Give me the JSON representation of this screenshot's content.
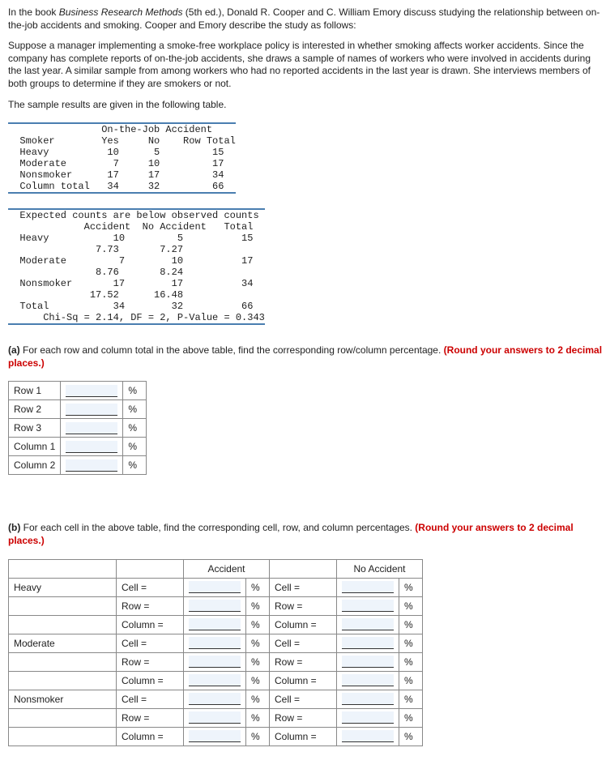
{
  "intro": {
    "line1_a": "In the book ",
    "book": "Business Research Methods",
    "line1_b": " (5th ed.), Donald R. Cooper and C. William Emory discuss studying the relationship between on-the-job accidents and smoking. Cooper and Emory describe the study as follows:",
    "suppose": "Suppose a manager implementing a smoke-free workplace policy is interested in whether smoking affects worker accidents. Since the company has complete reports of on-the-job accidents, she draws a sample of names of workers who were involved in accidents during the last year. A similar sample from among workers who had no reported accidents in the last year is drawn. She interviews members of both groups to determine if they are smokers or not.",
    "sample": "The sample results are given in the following table."
  },
  "table1_text": "                On-the-Job Accident\n  Smoker        Yes     No    Row Total\n  Heavy          10      5         15\n  Moderate        7     10         17\n  Nonsmoker      17     17         34\n  Column total   34     32         66",
  "table2_text": "  Expected counts are below observed counts\n             Accident  No Accident   Total\n  Heavy           10         5          15\n               7.73       7.27\n  Moderate         7        10          17\n               8.76       8.24\n  Nonsmoker       17        17          34\n              17.52      16.48\n  Total           34        32          66\n      Chi-Sq = 2.14, DF = 2, P-Value = 0.343",
  "qa": {
    "label": "(a)",
    "text": " For each row and column total in the above table, find the corresponding row/column percentage. ",
    "round": "(Round your answers to 2 decimal places.)"
  },
  "rows_a": {
    "r1": "Row 1",
    "r2": "Row 2",
    "r3": "Row 3",
    "c1": "Column 1",
    "c2": "Column 2",
    "pct": "%"
  },
  "qb": {
    "label": "(b)",
    "text": " For each cell in the above table, find the corresponding cell, row, and column percentages. ",
    "round": "(Round your answers to 2 decimal places.)"
  },
  "tb": {
    "acc": "Accident",
    "noacc": "No Accident",
    "heavy": "Heavy",
    "moderate": "Moderate",
    "nonsmoker": "Nonsmoker",
    "cell": "Cell =",
    "row": "Row =",
    "col": "Column =",
    "pct": "%"
  }
}
